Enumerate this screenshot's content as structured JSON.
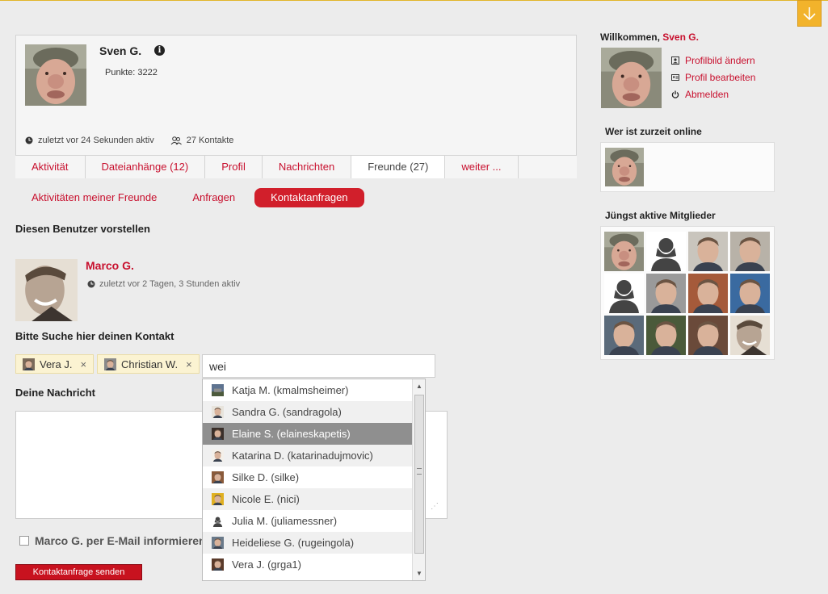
{
  "profile": {
    "name": "Sven G.",
    "points": "Punkte: 3222",
    "last_active": "zuletzt vor 24 Sekunden aktiv",
    "contacts": "27 Kontakte"
  },
  "tabs": [
    {
      "label": "Aktivität"
    },
    {
      "label": "Dateianhänge (12)"
    },
    {
      "label": "Profil"
    },
    {
      "label": "Nachrichten"
    },
    {
      "label": "Freunde (27)",
      "active": true
    },
    {
      "label": "weiter ..."
    }
  ],
  "subtabs": [
    {
      "label": "Aktivitäten meiner Freunde"
    },
    {
      "label": "Anfragen"
    },
    {
      "label": "Kontaktanfragen",
      "active": true
    }
  ],
  "intro": {
    "heading": "Diesen Benutzer vorstellen",
    "user_name": "Marco G.",
    "user_status": "zuletzt vor 2 Tagen, 3 Stunden aktiv"
  },
  "search": {
    "heading": "Bitte Suche hier deinen Kontakt",
    "tokens": [
      {
        "label": "Vera J.",
        "remove": "×"
      },
      {
        "label": "Christian W.",
        "remove": "×"
      }
    ],
    "value": "wei",
    "suggestions": [
      {
        "label": "Katja M. (kmalmsheimer)"
      },
      {
        "label": "Sandra G. (sandragola)"
      },
      {
        "label": "Elaine S. (elaineskapetis)",
        "highlighted": true
      },
      {
        "label": "Katarina D. (katarinadujmovic)"
      },
      {
        "label": "Silke D. (silke)"
      },
      {
        "label": "Nicole E. (nici)"
      },
      {
        "label": "Julia M. (juliamessner)"
      },
      {
        "label": "Heideliese G. (rugeingola)"
      },
      {
        "label": "Vera J. (grga1)"
      }
    ]
  },
  "message": {
    "heading": "Deine Nachricht",
    "value": ""
  },
  "email_option": {
    "label": "Marco G. per E-Mail informieren",
    "checked": false
  },
  "send_button": "Kontaktanfrage senden",
  "sidebar": {
    "welcome_prefix": "Willkommen,",
    "welcome_name": "Sven G.",
    "links": [
      {
        "label": "Profilbild ändern",
        "icon": "portrait-icon"
      },
      {
        "label": "Profil bearbeiten",
        "icon": "id-card-icon"
      },
      {
        "label": "Abmelden",
        "icon": "power-icon"
      }
    ],
    "online_heading": "Wer ist zurzeit online",
    "recent_heading": "Jüngst aktive Mitglieder"
  },
  "colors": {
    "accent": "#c8102e",
    "button_red": "#d11f2b",
    "highlight_gray": "#8f8f8f",
    "token_bg": "#fbf3d2",
    "scroll_button": "#f2b32b"
  }
}
